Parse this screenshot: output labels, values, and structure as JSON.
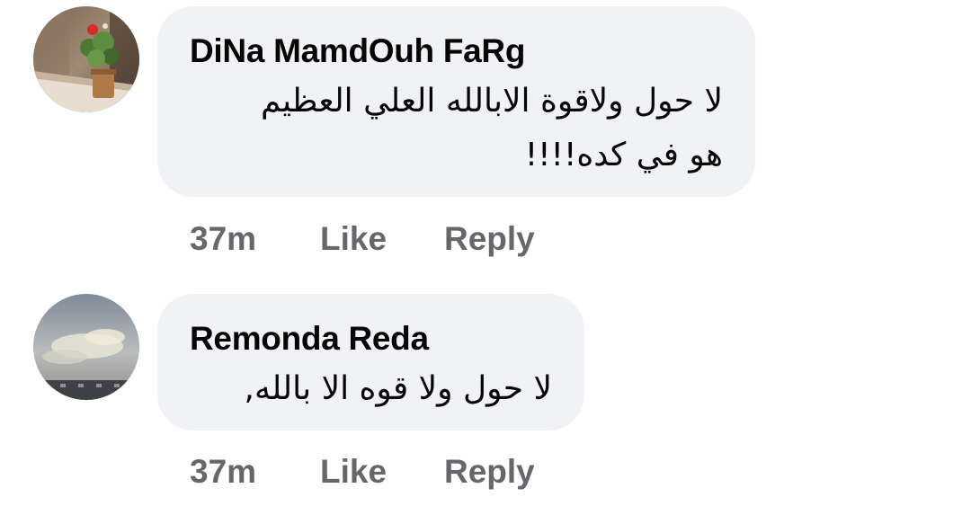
{
  "comments": [
    {
      "author": "DiNa MamdOuh FaRg",
      "text_line1": "لا حول ولاقوة الابالله العلي العظيم",
      "text_line2": "هو في كده!!!!",
      "time": "37m",
      "like_label": "Like",
      "reply_label": "Reply"
    },
    {
      "author": "Remonda Reda",
      "text_line1": "لا حول ولا قوه الا بالله,",
      "time": "37m",
      "like_label": "Like",
      "reply_label": "Reply"
    }
  ],
  "colors": {
    "bubble_bg": "#f0f2f5",
    "author_text": "#050505",
    "action_text": "#65676b"
  }
}
